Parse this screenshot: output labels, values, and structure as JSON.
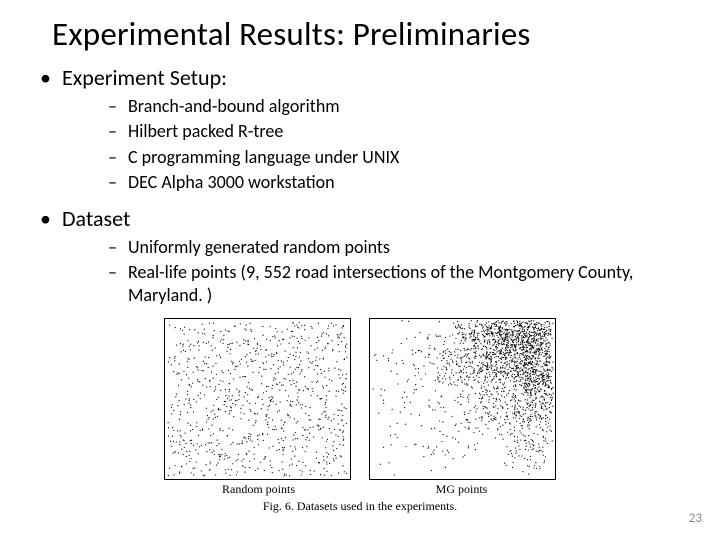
{
  "title": "Experimental Results: Preliminaries",
  "bullets": {
    "setup_label": "Experiment Setup:",
    "setup_items": [
      "Branch-and-bound algorithm",
      "Hilbert packed R-tree",
      "C programming language under UNIX",
      "DEC Alpha 3000 workstation"
    ],
    "dataset_label": "Dataset",
    "dataset_items": [
      "Uniformly generated random points",
      "Real-life points (9, 552 road intersections of the Montgomery County, Maryland. )"
    ]
  },
  "figure": {
    "left_label": "Random points",
    "right_label": "MG points",
    "caption": "Fig. 6. Datasets used in the experiments."
  },
  "page_number": "23",
  "chart_data": [
    {
      "type": "scatter",
      "title": "Random points",
      "description": "Uniformly distributed random points in the unit square",
      "n_points_approx": 1000,
      "distribution": "uniform",
      "xlim": [
        0,
        1
      ],
      "ylim": [
        0,
        1
      ]
    },
    {
      "type": "scatter",
      "title": "MG points",
      "description": "9552 road intersections of Montgomery County, Maryland (clustered, denser toward upper-right)",
      "n_points": 9552,
      "distribution": "real-world-clustered",
      "xlim": [
        0,
        1
      ],
      "ylim": [
        0,
        1
      ]
    }
  ]
}
